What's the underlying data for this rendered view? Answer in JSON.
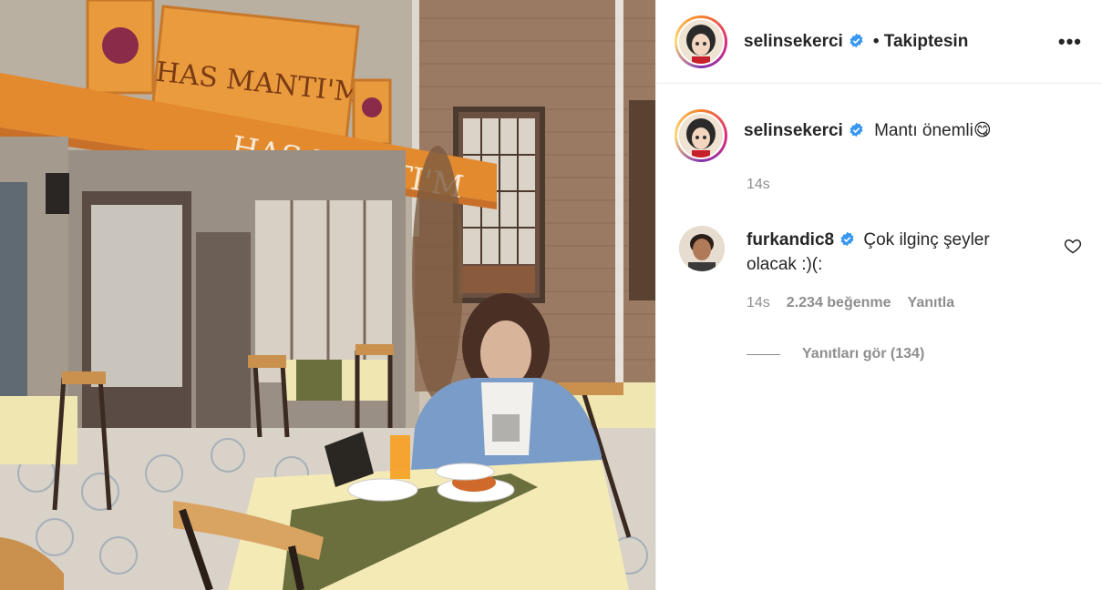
{
  "post": {
    "author": "selinsekerci",
    "follow_status": "• Takiptesin",
    "more_label": "•••",
    "caption": {
      "username": "selinsekerci",
      "text": "Mantı önemli",
      "emoji": "😋",
      "time": "14s"
    },
    "photo": {
      "sign_main": "HAS MANTI'M",
      "sign_awning": "HAS MANTI'M"
    }
  },
  "comments": [
    {
      "username": "furkandic8",
      "text": "Çok ilginç şeyler olacak :)(:",
      "time": "14s",
      "likes": "2.234 beğenme",
      "reply_label": "Yanıtla",
      "view_replies": "Yanıtları gör (134)"
    }
  ],
  "colors": {
    "verified": "#3897f0",
    "secondary_text": "#8e8e8e",
    "divider": "#efefef"
  }
}
